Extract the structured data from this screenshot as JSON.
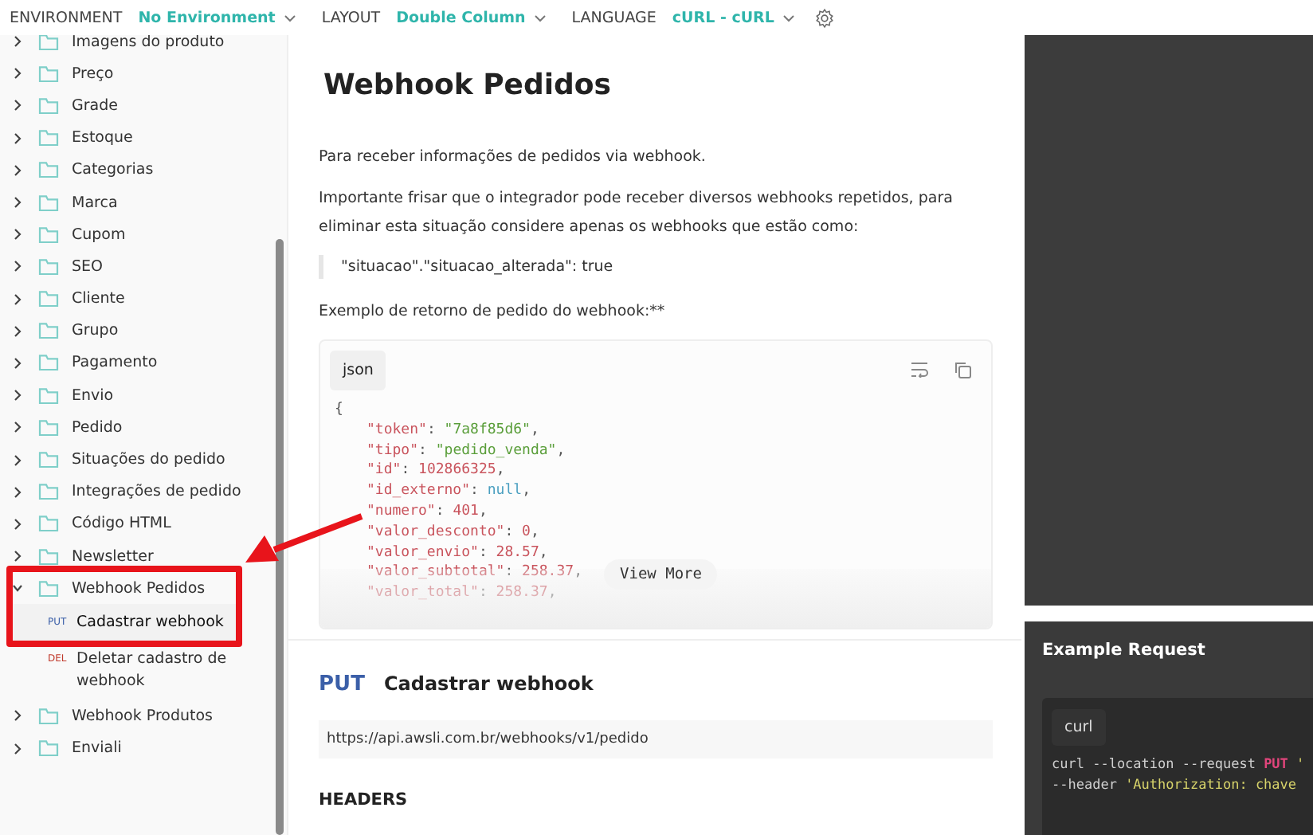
{
  "topbar": {
    "items": [
      {
        "label": "ENVIRONMENT",
        "value": "No Environment"
      },
      {
        "label": "LAYOUT",
        "value": "Double Column"
      },
      {
        "label": "LANGUAGE",
        "value": "cURL - cURL"
      }
    ]
  },
  "sidebar": {
    "items": [
      {
        "label": "Imagens do produto",
        "expanded": false
      },
      {
        "label": "Preço",
        "expanded": false
      },
      {
        "label": "Grade",
        "expanded": false
      },
      {
        "label": "Estoque",
        "expanded": false
      },
      {
        "label": "Categorias",
        "expanded": false
      },
      {
        "label": "Marca",
        "expanded": false
      },
      {
        "label": "Cupom",
        "expanded": false
      },
      {
        "label": "SEO",
        "expanded": false
      },
      {
        "label": "Cliente",
        "expanded": false
      },
      {
        "label": "Grupo",
        "expanded": false
      },
      {
        "label": "Pagamento",
        "expanded": false
      },
      {
        "label": "Envio",
        "expanded": false
      },
      {
        "label": "Pedido",
        "expanded": false
      },
      {
        "label": "Situações do pedido",
        "expanded": false
      },
      {
        "label": "Integrações de pedido",
        "expanded": false
      },
      {
        "label": "Código HTML",
        "expanded": false
      },
      {
        "label": "Newsletter",
        "expanded": false
      },
      {
        "label": "Webhook Pedidos",
        "expanded": true,
        "annotated": true,
        "children": [
          {
            "method": "PUT",
            "label": "Cadastrar webhook",
            "selected": true
          },
          {
            "method": "DEL",
            "label": "Deletar cadastro de webhook",
            "selected": false
          }
        ]
      },
      {
        "label": "Webhook Produtos",
        "expanded": false
      },
      {
        "label": "Enviali",
        "expanded": false
      }
    ]
  },
  "main": {
    "title": "Webhook Pedidos",
    "intro": "Para receber informações de pedidos via webhook.",
    "note": "Importante frisar que o integrador pode receber diversos webhooks repetidos, para eliminar esta situação considere apenas os webhooks que estão como:",
    "quote": "\"situacao\".\"situacao_alterada\": true",
    "example_label": "Exemplo de retorno de pedido do webhook:**",
    "code": {
      "language": "json",
      "open": "{",
      "view_more": "View More",
      "lines": [
        [
          {
            "text": "\"token\"",
            "kind": "key"
          },
          {
            "text": ": ",
            "kind": "punct"
          },
          {
            "text": "\"7a8f85d6\"",
            "kind": "string"
          },
          {
            "text": ",",
            "kind": "punct"
          }
        ],
        [
          {
            "text": "\"tipo\"",
            "kind": "key"
          },
          {
            "text": ": ",
            "kind": "punct"
          },
          {
            "text": "\"pedido_venda\"",
            "kind": "string"
          },
          {
            "text": ",",
            "kind": "punct"
          }
        ],
        [
          {
            "text": "\"id\"",
            "kind": "key"
          },
          {
            "text": ": ",
            "kind": "punct"
          },
          {
            "text": "102866325",
            "kind": "number"
          },
          {
            "text": ",",
            "kind": "punct"
          }
        ],
        [
          {
            "text": "\"id_externo\"",
            "kind": "key"
          },
          {
            "text": ": ",
            "kind": "punct"
          },
          {
            "text": "null",
            "kind": "null"
          },
          {
            "text": ",",
            "kind": "punct"
          }
        ],
        [
          {
            "text": "\"numero\"",
            "kind": "key"
          },
          {
            "text": ": ",
            "kind": "punct"
          },
          {
            "text": "401",
            "kind": "number"
          },
          {
            "text": ",",
            "kind": "punct"
          }
        ],
        [
          {
            "text": "\"valor_desconto\"",
            "kind": "key"
          },
          {
            "text": ": ",
            "kind": "punct"
          },
          {
            "text": "0",
            "kind": "number"
          },
          {
            "text": ",",
            "kind": "punct"
          }
        ],
        [
          {
            "text": "\"valor_envio\"",
            "kind": "key"
          },
          {
            "text": ": ",
            "kind": "punct"
          },
          {
            "text": "28.57",
            "kind": "number"
          },
          {
            "text": ",",
            "kind": "punct"
          }
        ],
        [
          {
            "text": "\"valor_subtotal\"",
            "kind": "key"
          },
          {
            "text": ": ",
            "kind": "punct"
          },
          {
            "text": "258.37",
            "kind": "number"
          },
          {
            "text": ",",
            "kind": "punct"
          }
        ],
        [
          {
            "text": "\"valor_total\"",
            "kind": "key"
          },
          {
            "text": ": ",
            "kind": "punct"
          },
          {
            "text": "258.37",
            "kind": "number"
          },
          {
            "text": ",",
            "kind": "punct"
          }
        ]
      ]
    },
    "endpoint": {
      "method": "PUT",
      "name": "Cadastrar webhook",
      "url": "https://api.awsli.com.br/webhooks/v1/pedido",
      "section": "HEADERS"
    }
  },
  "example_request": {
    "title": "Example Request",
    "language": "curl",
    "lines": [
      [
        {
          "text": "curl --location --request ",
          "kind": "plain"
        },
        {
          "text": "PUT",
          "kind": "keyword"
        },
        {
          "text": " '",
          "kind": "string"
        }
      ],
      [
        {
          "text": "--header ",
          "kind": "plain"
        },
        {
          "text": "'Authorization: chave",
          "kind": "string"
        }
      ]
    ]
  }
}
